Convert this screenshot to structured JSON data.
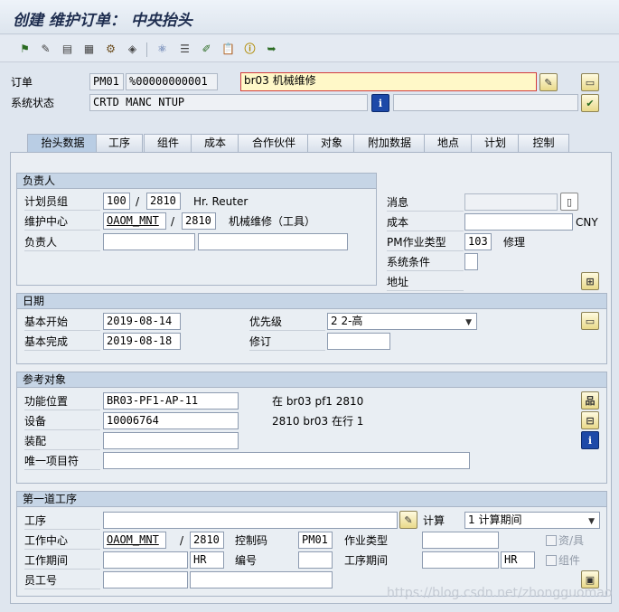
{
  "title": "创建 维护订单： 中央抬头",
  "toolbar": [
    "flag-icon",
    "change-icon",
    "document-icon",
    "calculator-icon",
    "hierarchy-icon",
    "object-icon",
    "component-icon",
    "list-icon",
    "edit-icon",
    "clipboard-icon",
    "info-icon",
    "redo-icon"
  ],
  "header": {
    "order_label": "订单",
    "order_type": "PM01",
    "order_number": "%00000000001",
    "order_text": "br03 机械维修",
    "status_label": "系统状态",
    "status_value": "CRTD MANC NTUP"
  },
  "tabs": [
    "抬头数据",
    "工序",
    "组件",
    "成本",
    "合作伙伴",
    "对象",
    "附加数据",
    "地点",
    "计划",
    "控制"
  ],
  "responsible": {
    "title": "负责人",
    "planner_group_label": "计划员组",
    "planner_group": "100",
    "planner_plant": "2810",
    "planner_name": "Hr. Reuter",
    "work_center_label": "维护中心",
    "work_center": "OAOM_MNT",
    "work_center_plant": "2810",
    "work_center_desc": "机械维修（工具）",
    "person_label": "负责人",
    "notification_label": "消息",
    "cost_label": "成本",
    "currency": "CNY",
    "activity_type_label": "PM作业类型",
    "activity_type": "103",
    "activity_type_desc": "修理",
    "system_condition_label": "系统条件",
    "address_label": "地址"
  },
  "dates": {
    "title": "日期",
    "basic_start_label": "基本开始",
    "basic_start": "2019-08-14",
    "basic_finish_label": "基本完成",
    "basic_finish": "2019-08-18",
    "priority_label": "优先级",
    "priority": "2 2-高",
    "revision_label": "修订"
  },
  "reference": {
    "title": "参考对象",
    "func_loc_label": "功能位置",
    "func_loc": "BR03-PF1-AP-11",
    "func_loc_desc": "在 br03 pf1 2810",
    "equipment_label": "设备",
    "equipment": "10006764",
    "equipment_desc": "2810 br03 在行 1",
    "assembly_label": "装配",
    "unique_item_label": "唯一项目符"
  },
  "first_operation": {
    "title": "第一道工序",
    "operation_label": "工序",
    "calc_label": "计算",
    "calc_value": "1 计算期间",
    "work_center_label": "工作中心",
    "work_center": "OAOM_MNT",
    "plant": "2810",
    "control_key_label": "控制码",
    "control_key": "PM01",
    "activity_type_label": "作业类型",
    "resources_label": "资/具",
    "work_period_label": "工作期间",
    "work_unit": "HR",
    "number_label": "编号",
    "op_period_label": "工序期间",
    "op_unit": "HR",
    "component_label": "组件",
    "personnel_label": "员工号"
  },
  "watermark": "https://blog.csdn.net/zhongguomao"
}
